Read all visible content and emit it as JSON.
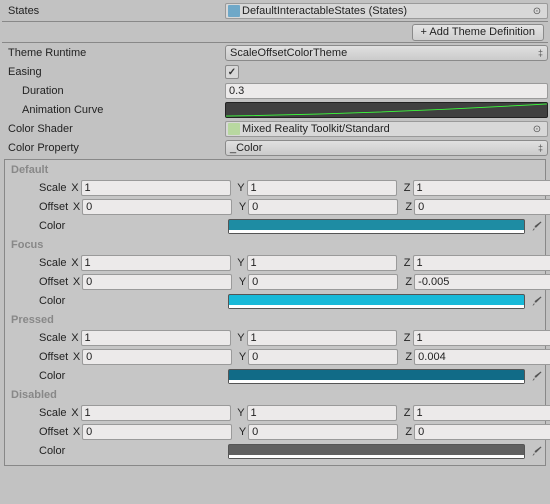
{
  "header": {
    "states_label": "States",
    "states_value": "DefaultInteractableStates (States)",
    "add_theme_btn": "+ Add Theme Definition"
  },
  "props": {
    "theme_runtime_label": "Theme Runtime",
    "theme_runtime_value": "ScaleOffsetColorTheme",
    "easing_label": "Easing",
    "easing_checked": true,
    "duration_label": "Duration",
    "duration_value": "0.3",
    "anim_curve_label": "Animation Curve",
    "color_shader_label": "Color Shader",
    "color_shader_value": "Mixed Reality Toolkit/Standard",
    "color_property_label": "Color Property",
    "color_property_value": "_Color"
  },
  "axis": {
    "x": "X",
    "y": "Y",
    "z": "Z"
  },
  "field_labels": {
    "scale": "Scale",
    "offset": "Offset",
    "color": "Color"
  },
  "states": [
    {
      "name": "Default",
      "scale": {
        "x": "1",
        "y": "1",
        "z": "1"
      },
      "offset": {
        "x": "0",
        "y": "0",
        "z": "0"
      },
      "color": "#1e8ca3"
    },
    {
      "name": "Focus",
      "scale": {
        "x": "1",
        "y": "1",
        "z": "1"
      },
      "offset": {
        "x": "0",
        "y": "0",
        "z": "-0.005"
      },
      "color": "#18b9d8"
    },
    {
      "name": "Pressed",
      "scale": {
        "x": "1",
        "y": "1",
        "z": "1"
      },
      "offset": {
        "x": "0",
        "y": "0",
        "z": "0.004"
      },
      "color": "#116b87"
    },
    {
      "name": "Disabled",
      "scale": {
        "x": "1",
        "y": "1",
        "z": "1"
      },
      "offset": {
        "x": "0",
        "y": "0",
        "z": "0"
      },
      "color": "#606060"
    }
  ]
}
